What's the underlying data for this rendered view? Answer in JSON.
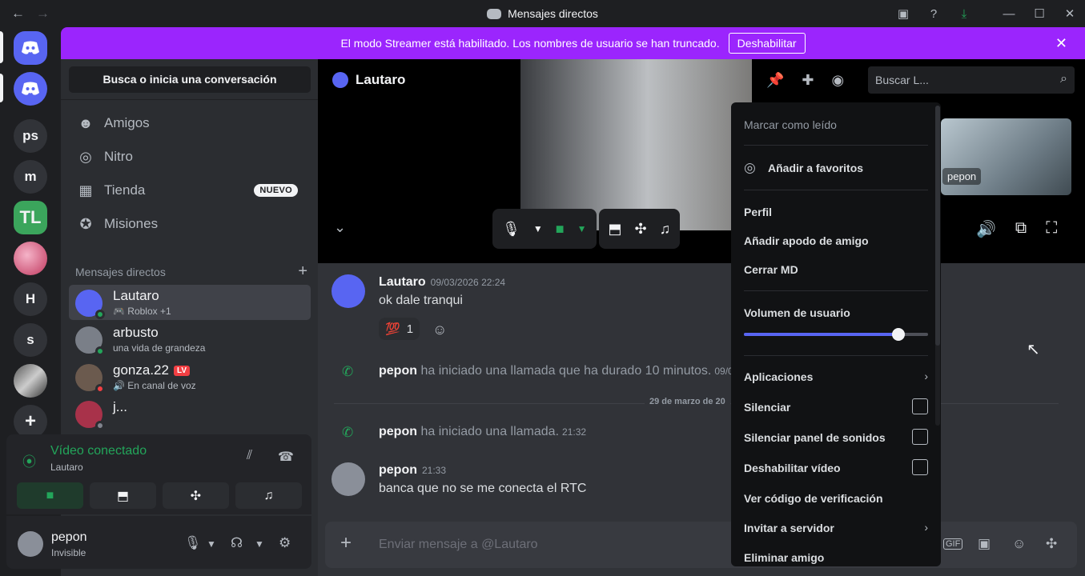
{
  "titlebar": {
    "title": "Mensajes directos",
    "back": "←",
    "forward": "→",
    "icons": [
      "inbox-icon",
      "help-icon",
      "download-icon"
    ],
    "window": [
      "—",
      "☐",
      "✕"
    ]
  },
  "guilds": [
    {
      "label": "",
      "name": "discord-home"
    },
    {
      "label": "",
      "name": "discord-dm"
    },
    {
      "label": "ps"
    },
    {
      "label": "m"
    },
    {
      "label": "TL"
    },
    {
      "label": ""
    },
    {
      "label": "H"
    },
    {
      "label": "s"
    },
    {
      "label": ""
    },
    {
      "label": "+"
    }
  ],
  "banner": {
    "text": "El modo Streamer está habilitado. Los nombres de usuario se han truncado.",
    "button": "Deshabilitar",
    "close": "✕"
  },
  "sidebar": {
    "search": "Busca o inicia una conversación",
    "nav": [
      {
        "label": "Amigos",
        "icon": "friends-icon",
        "glyph": "☻"
      },
      {
        "label": "Nitro",
        "icon": "nitro-icon",
        "glyph": "◎"
      },
      {
        "label": "Tienda",
        "icon": "shop-icon",
        "glyph": "▦",
        "badge": "NUEVO"
      },
      {
        "label": "Misiones",
        "icon": "quests-icon",
        "glyph": "✪"
      }
    ],
    "dm_header": "Mensajes directos",
    "dm_add": "+",
    "dms": [
      {
        "name": "Lautaro",
        "sub": "🎮 Roblox +1",
        "status": "#23a55a",
        "avatar": "#5865f2"
      },
      {
        "name": "arbusto",
        "sub": "una vida de grandeza",
        "status": "#23a55a",
        "avatar": "#7a7f88"
      },
      {
        "name": "gonza.22",
        "tag": "LV",
        "sub": "🔊 En canal de voz",
        "status": "#f23f43",
        "avatar": "#6b5a4e"
      },
      {
        "name": "j...",
        "sub": "",
        "status": "#80848e",
        "avatar": "#a8324a"
      }
    ]
  },
  "voice": {
    "title": "Vídeo conectado",
    "sub": "Lautaro"
  },
  "user": {
    "name": "pepon",
    "status": "Invisible"
  },
  "call": {
    "header_name": "Lautaro",
    "search_placeholder": "Buscar L...",
    "remote_label": "pepon"
  },
  "chat": {
    "msg1": {
      "name": "Lautaro",
      "time": "09/03/2026 22:24",
      "text": "ok dale tranqui",
      "reaction_emoji": "💯",
      "reaction_count": "1"
    },
    "sys1": {
      "name": "pepon",
      "text": "ha iniciado una llamada que ha durado 10 minutos.",
      "time": "09/0"
    },
    "date_separator": "29 de marzo de 20",
    "sys2": {
      "name": "pepon",
      "text": "ha iniciado una llamada.",
      "time": "21:32"
    },
    "msg2": {
      "name": "pepon",
      "time": "21:33",
      "text": "banca que no se me conecta el RTC"
    },
    "composer_placeholder": "Enviar mensaje a @Lautaro",
    "composer_gif": "GIF"
  },
  "menu": {
    "mark_read": "Marcar como leído",
    "favorite": "Añadir a favoritos",
    "profile": "Perfil",
    "nickname": "Añadir apodo de amigo",
    "close_dm": "Cerrar MD",
    "volume_label": "Volumen de usuario",
    "volume_value": 0.84,
    "apps": "Aplicaciones",
    "mute": "Silenciar",
    "mute_soundboard": "Silenciar panel de sonidos",
    "disable_video": "Deshabilitar vídeo",
    "verify": "Ver código de verificación",
    "invite": "Invitar a servidor",
    "remove": "Eliminar amigo"
  },
  "colors": {
    "accent": "#5865f2",
    "banner": "#9b25fd",
    "online": "#23a55a",
    "dnd": "#f23f43"
  }
}
